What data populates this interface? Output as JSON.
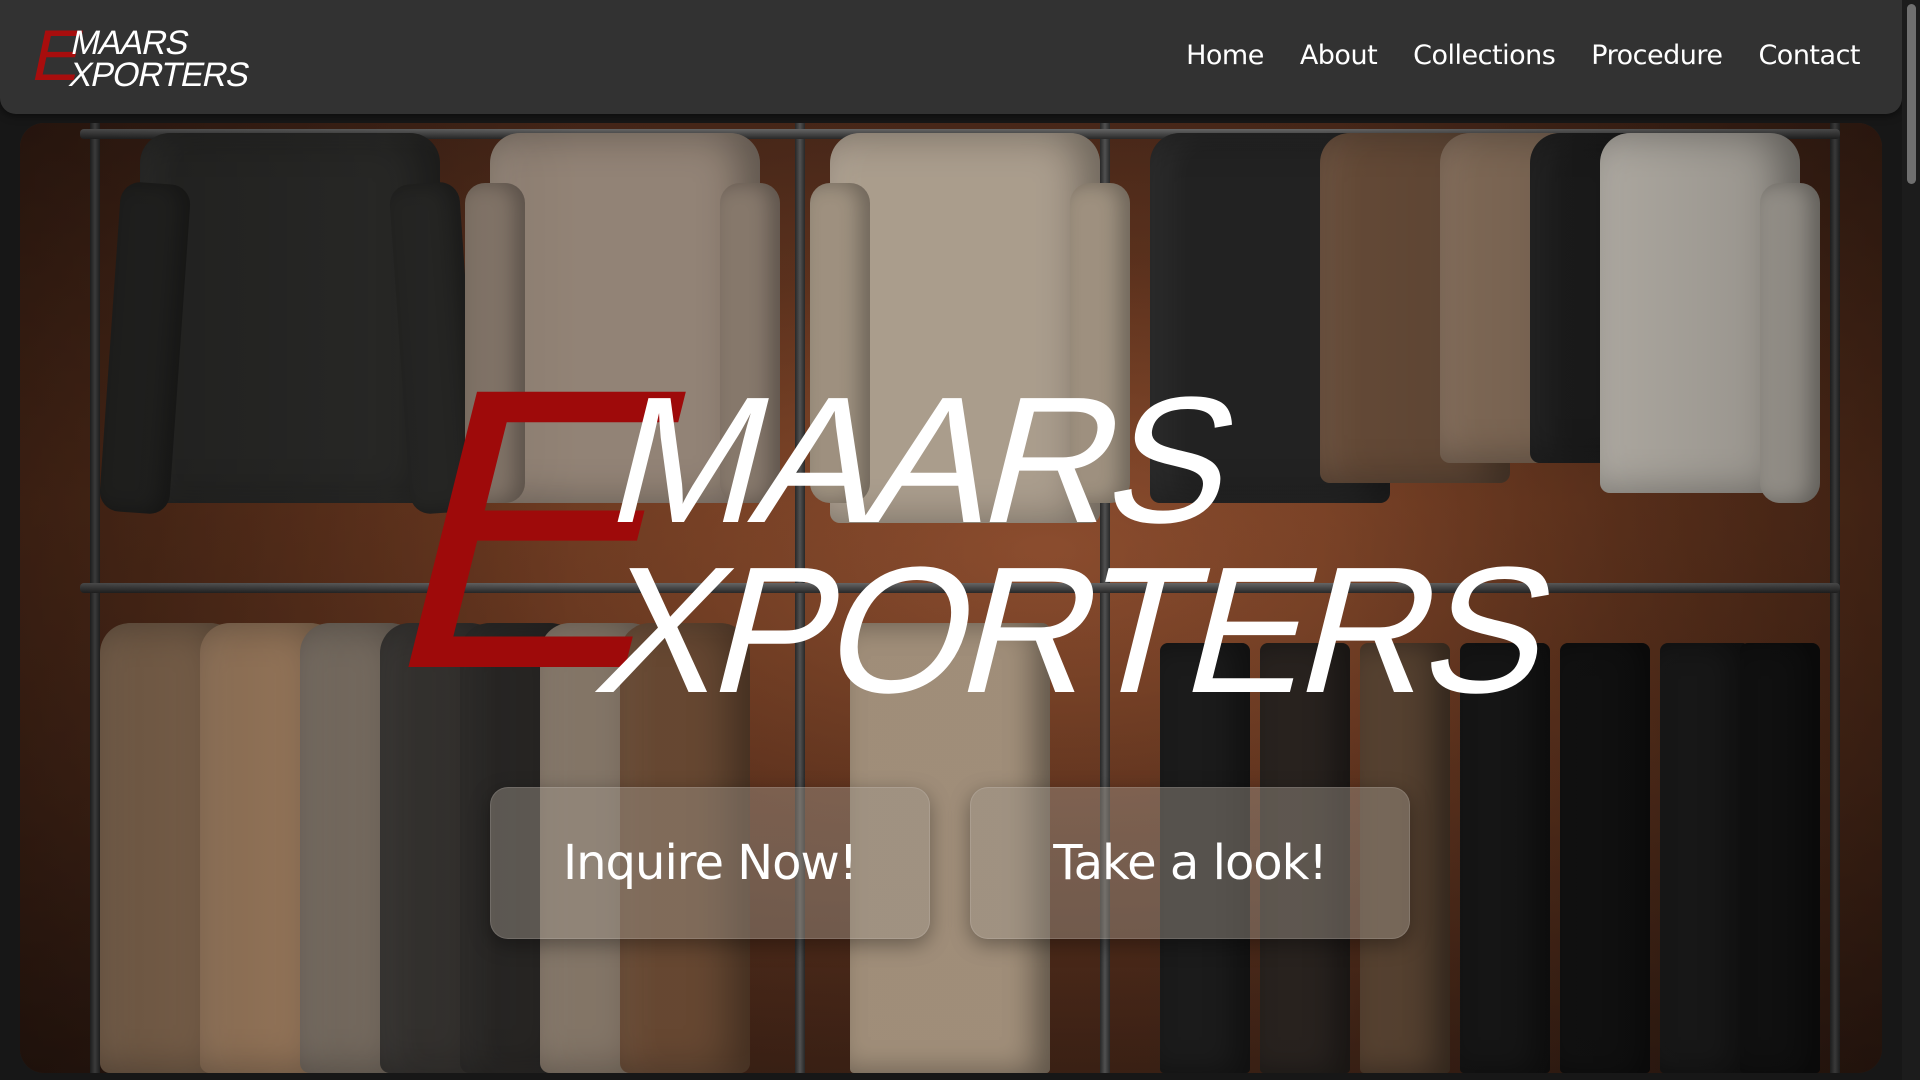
{
  "brand": {
    "initial": "E",
    "line1": "MAARS",
    "line2": "XPORTERS"
  },
  "nav": {
    "items": [
      {
        "label": "Home"
      },
      {
        "label": "About"
      },
      {
        "label": "Collections"
      },
      {
        "label": "Procedure"
      },
      {
        "label": "Contact"
      }
    ]
  },
  "hero": {
    "logo": {
      "initial": "E",
      "line1": "MAARS",
      "line2": "XPORTERS"
    },
    "buttons": {
      "inquire_label": "Inquire Now!",
      "look_label": "Take a look!"
    }
  },
  "colors": {
    "accent_red": "#9e0a0a",
    "navbar_bg": "#323232",
    "text_white": "#ffffff"
  }
}
